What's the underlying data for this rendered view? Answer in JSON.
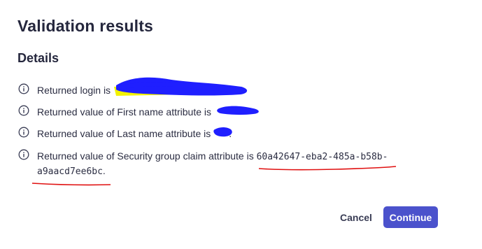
{
  "dialog": {
    "title": "Validation results",
    "details_heading": "Details",
    "results": [
      {
        "icon": "info-icon",
        "text": "Returned login is "
      },
      {
        "icon": "info-icon",
        "text": "Returned value of First name attribute is "
      },
      {
        "icon": "info-icon",
        "text": "Returned value of Last name attribute is"
      },
      {
        "icon": "info-icon",
        "text_prefix": "Returned value of Security group claim attribute is ",
        "value_line1": "60a42647-eba2-485a-b58b-",
        "value_line2": "a9aacd7ee6bc",
        "suffix": "."
      }
    ],
    "cancel_label": "Cancel",
    "continue_label": "Continue"
  },
  "colors": {
    "accent": "#4b52cc",
    "redaction_blue": "#1f1fff",
    "highlight_yellow": "#f2f200",
    "underline_red": "#e01010"
  }
}
